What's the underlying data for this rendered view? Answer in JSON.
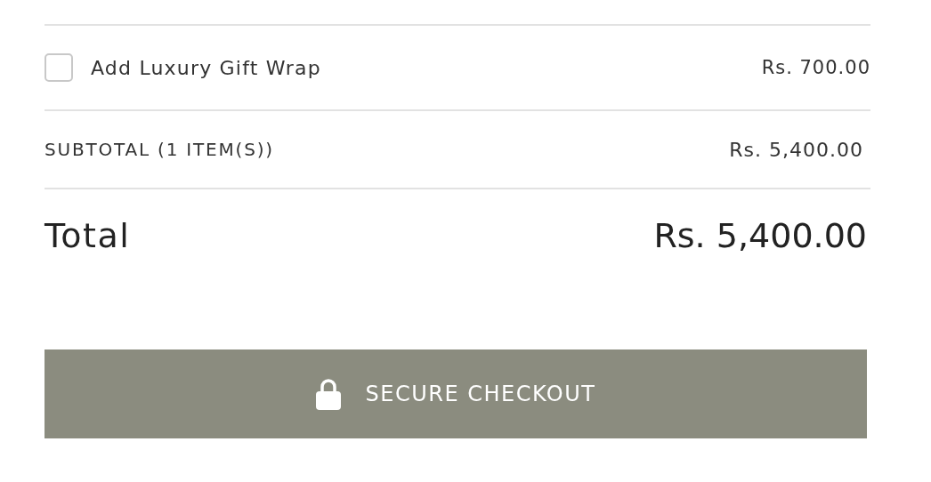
{
  "gift_wrap": {
    "label": "Add Luxury Gift Wrap",
    "price": "Rs. 700.00",
    "checked": false
  },
  "subtotal": {
    "label": "SUBTOTAL (1 ITEM(S))",
    "value": "Rs. 5,400.00"
  },
  "total": {
    "label": "Total",
    "value": "Rs. 5,400.00"
  },
  "checkout_button": {
    "label": "SECURE CHECKOUT"
  }
}
